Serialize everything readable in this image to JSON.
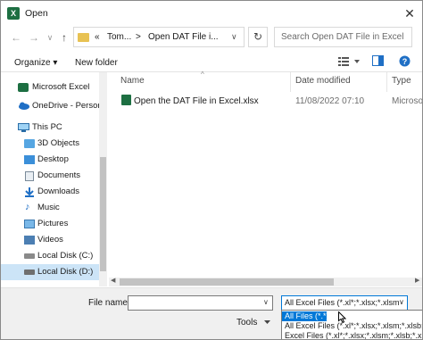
{
  "window": {
    "title": "Open",
    "app_icon": "X"
  },
  "address": {
    "back": "←",
    "forward": "→",
    "recent": "∨",
    "up": "↑",
    "parts": [
      "«",
      "Tom...",
      ">",
      "Open DAT File i..."
    ],
    "refresh": "↻"
  },
  "search": {
    "placeholder": "Search Open DAT File in Excel"
  },
  "toolbar": {
    "organize": "Organize ▾",
    "new_folder": "New folder"
  },
  "sidebar": {
    "items": [
      {
        "label": "Microsoft Excel",
        "icon": "excel-icon"
      },
      {
        "label": "OneDrive - Person",
        "icon": "cloud-icon"
      },
      {
        "label": "This PC",
        "icon": "pc-icon"
      },
      {
        "label": "3D Objects",
        "icon": "cube-icon"
      },
      {
        "label": "Desktop",
        "icon": "desktop-icon"
      },
      {
        "label": "Documents",
        "icon": "document-icon"
      },
      {
        "label": "Downloads",
        "icon": "download-icon"
      },
      {
        "label": "Music",
        "icon": "music-icon"
      },
      {
        "label": "Pictures",
        "icon": "picture-icon"
      },
      {
        "label": "Videos",
        "icon": "video-icon"
      },
      {
        "label": "Local Disk (C:)",
        "icon": "disk-icon"
      },
      {
        "label": "Local Disk (D:)",
        "icon": "disk-icon",
        "selected": true
      }
    ]
  },
  "file_list": {
    "columns": [
      "Name",
      "Date modified",
      "Type"
    ],
    "rows": [
      {
        "name": "Open the DAT File in Excel.xlsx",
        "date": "11/08/2022 07:10",
        "type": "Microso"
      }
    ]
  },
  "bottom": {
    "file_name_label": "File name:",
    "file_name_value": "",
    "filter_selected": "All Excel Files (*.xl*;*.xlsx;*.xlsm",
    "filter_options": [
      "All Files (*.*)",
      "All Excel Files (*.xl*;*.xlsx;*.xlsm;*.xlsb;",
      "Excel Files (*.xl*;*.xlsx;*.xlsm;*.xlsb;*.xl"
    ],
    "tools": "Tools"
  },
  "colors": {
    "accent": "#0078d7",
    "excel_green": "#1d6f42",
    "selection": "#cce4f7"
  }
}
